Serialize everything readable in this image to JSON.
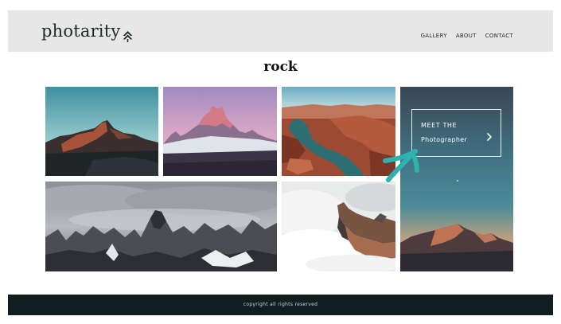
{
  "header": {
    "logo_text": "photarity",
    "logo_icon": "pine-tree-icon",
    "nav": [
      "GALLERY",
      "ABOUT",
      "CONTACT"
    ]
  },
  "page": {
    "title": "rock"
  },
  "gallery": {
    "photos": [
      {
        "name": "mountain-peak-sunset-photo"
      },
      {
        "name": "pink-sky-mountains-photo"
      },
      {
        "name": "river-canyon-aerial-photo"
      },
      {
        "name": "mountain-dusk-sky-photo"
      },
      {
        "name": "storm-cloud-peaks-photo"
      },
      {
        "name": "cloud-rock-ridge-photo"
      }
    ],
    "meet": {
      "line1": "MEET THE",
      "line2": "Photographer",
      "icon": "chevron-right-icon"
    }
  },
  "annotation": {
    "icon": "teal-arrow-pointer",
    "color": "#2bb3b0"
  },
  "footer": {
    "text": "copyright all rights reserved"
  },
  "colors": {
    "header_bg": "#e8e7e8",
    "footer_bg": "#101e1f",
    "text_dark": "#1d2a28"
  }
}
